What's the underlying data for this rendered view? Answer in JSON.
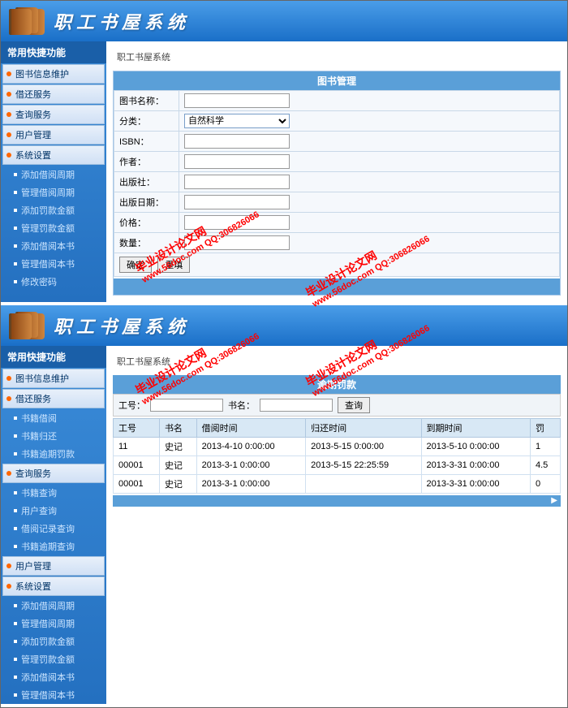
{
  "header": {
    "title": "职工书屋系统"
  },
  "sidebar": {
    "title": "常用快捷功能",
    "top_groups": [
      "图书信息维护",
      "借还服务",
      "查询服务",
      "用户管理",
      "系统设置"
    ],
    "top_subs": [
      "添加借阅周期",
      "管理借阅周期",
      "添加罚款金额",
      "管理罚款金额",
      "添加借阅本书",
      "管理借阅本书",
      "修改密码"
    ],
    "bottom_groups1": [
      "图书信息维护",
      "借还服务"
    ],
    "bottom_subs1": [
      "书籍借阅",
      "书籍归还",
      "书籍逾期罚款"
    ],
    "bottom_group_query": "查询服务",
    "bottom_subs2": [
      "书籍查询",
      "用户查询",
      "借阅记录查询",
      "书籍逾期查询"
    ],
    "bottom_group_user": "用户管理",
    "bottom_group_sys": "系统设置",
    "bottom_subs3": [
      "添加借阅周期",
      "管理借阅周期",
      "添加罚款金额",
      "管理罚款金额",
      "添加借阅本书",
      "管理借阅本书"
    ]
  },
  "breadcrumb": "职工书屋系统",
  "form": {
    "title": "图书管理",
    "fields": {
      "name": "图书名称：",
      "category": "分类：",
      "isbn": "ISBN：",
      "author": "作者：",
      "publisher": "出版社：",
      "pubdate": "出版日期：",
      "price": "价格：",
      "qty": "数量："
    },
    "category_value": "自然科学",
    "btn_ok": "确定",
    "btn_reset": "重填"
  },
  "search": {
    "label_id": "工号：",
    "label_name": "书名：",
    "btn": "查询"
  },
  "table": {
    "title": "逾期罚款",
    "cols": [
      "工号",
      "书名",
      "借阅时间",
      "归还时间",
      "到期时间",
      "罚"
    ],
    "rows": [
      [
        "11",
        "史记",
        "2013-4-10 0:00:00",
        "2013-5-15 0:00:00",
        "2013-5-10 0:00:00",
        "1"
      ],
      [
        "00001",
        "史记",
        "2013-3-1 0:00:00",
        "2013-5-15 22:25:59",
        "2013-3-31 0:00:00",
        "4.5"
      ],
      [
        "00001",
        "史记",
        "2013-3-1 0:00:00",
        "",
        "2013-3-31 0:00:00",
        "0"
      ]
    ]
  },
  "watermark": {
    "l1": "毕业设计论文网",
    "l2": "www.56doc.com  QQ:306826066"
  }
}
